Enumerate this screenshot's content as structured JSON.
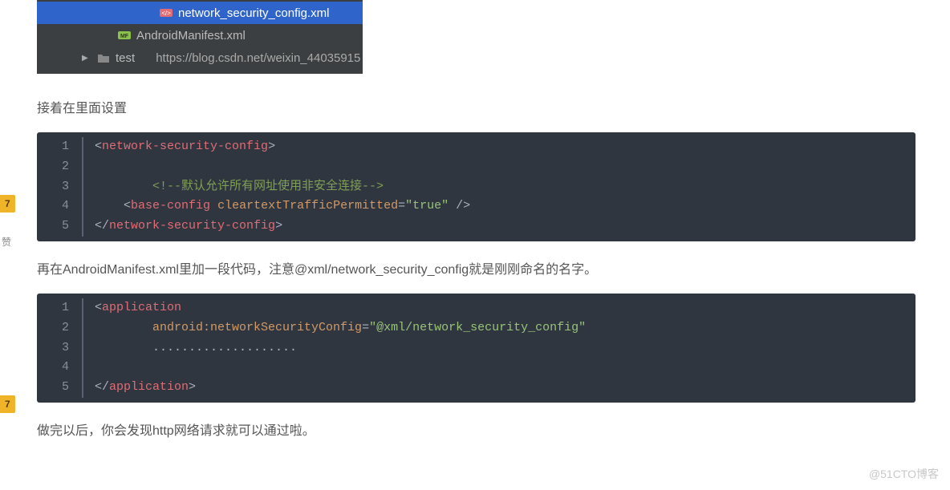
{
  "ide": {
    "file1": "network_security_config.xml",
    "file2": "AndroidManifest.xml",
    "folder": "test",
    "url": "https://blog.csdn.net/weixin_44035915"
  },
  "text": {
    "p1": "接着在里面设置",
    "p2": "再在AndroidManifest.xml里加一段代码，注意@xml/network_security_config就是刚刚命名的名字。",
    "p3": "做完以后，你会发现http网络请求就可以通过啦。"
  },
  "code1": {
    "l1_a": "<",
    "l1_b": "network-security-config",
    "l1_c": ">",
    "l3": "<!--默认允许所有网址使用非安全连接-->",
    "l4_a": "<",
    "l4_b": "base-config",
    "l4_sp": " ",
    "l4_c": "cleartextTrafficPermitted",
    "l4_d": "=",
    "l4_e": "\"true\"",
    "l4_f": " />",
    "l5_a": "</",
    "l5_b": "network-security-config",
    "l5_c": ">",
    "n1": "1",
    "n2": "2",
    "n3": "3",
    "n4": "4",
    "n5": "5"
  },
  "code2": {
    "l1_a": "<",
    "l1_b": "application",
    "l2_a": "android:networkSecurityConfig",
    "l2_b": "=",
    "l2_c": "\"@xml/network_security_config\"",
    "l3": "....................",
    "l5_a": "</",
    "l5_b": "application",
    "l5_c": ">",
    "n1": "1",
    "n2": "2",
    "n3": "3",
    "n4": "4",
    "n5": "5"
  },
  "share": {
    "badge1": "7",
    "badge2": "7",
    "label1": "赞"
  },
  "watermark": "@51CTO博客"
}
